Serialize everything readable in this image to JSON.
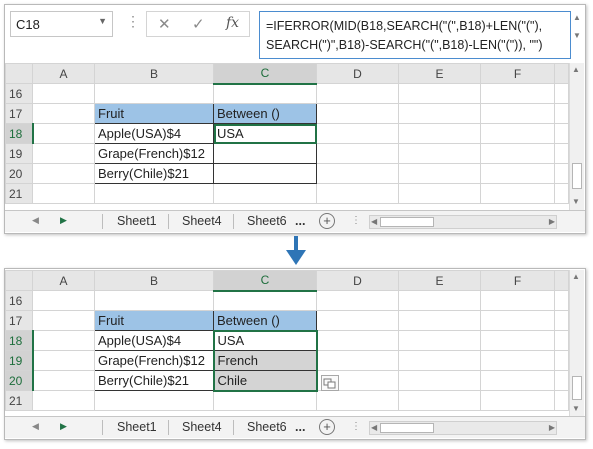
{
  "formula_bar": {
    "name_box": "C18",
    "fx_label": "fx",
    "formula_line1": "=IFERROR(MID(B18,SEARCH(\"(\",B18)+LEN(\"(\"),",
    "formula_line2": "SEARCH(\")\",B18)-SEARCH(\"(\",B18)-LEN(\"(\")), \"\")"
  },
  "columns": [
    "A",
    "B",
    "C",
    "D",
    "E",
    "F"
  ],
  "top_grid": {
    "rows": [
      {
        "num": "16",
        "b": "",
        "c": ""
      },
      {
        "num": "17",
        "b": "Fruit",
        "c": "Between ()"
      },
      {
        "num": "18",
        "b": "Apple(USA)$4",
        "c": "USA"
      },
      {
        "num": "19",
        "b": "Grape(French)$12",
        "c": ""
      },
      {
        "num": "20",
        "b": "Berry(Chile)$21",
        "c": ""
      },
      {
        "num": "21",
        "b": "",
        "c": ""
      }
    ]
  },
  "bottom_grid": {
    "rows": [
      {
        "num": "16",
        "b": "",
        "c": ""
      },
      {
        "num": "17",
        "b": "Fruit",
        "c": "Between ()"
      },
      {
        "num": "18",
        "b": "Apple(USA)$4",
        "c": "USA"
      },
      {
        "num": "19",
        "b": "Grape(French)$12",
        "c": "French"
      },
      {
        "num": "20",
        "b": "Berry(Chile)$21",
        "c": "Chile"
      },
      {
        "num": "21",
        "b": "",
        "c": ""
      }
    ]
  },
  "tabs": {
    "sheets": [
      "Sheet1",
      "Sheet4",
      "Sheet6"
    ],
    "more": "...",
    "add": "+"
  },
  "colors": {
    "header_fill": "#9dc3e6",
    "selection": "#217346",
    "arrow": "#2e75b6"
  }
}
